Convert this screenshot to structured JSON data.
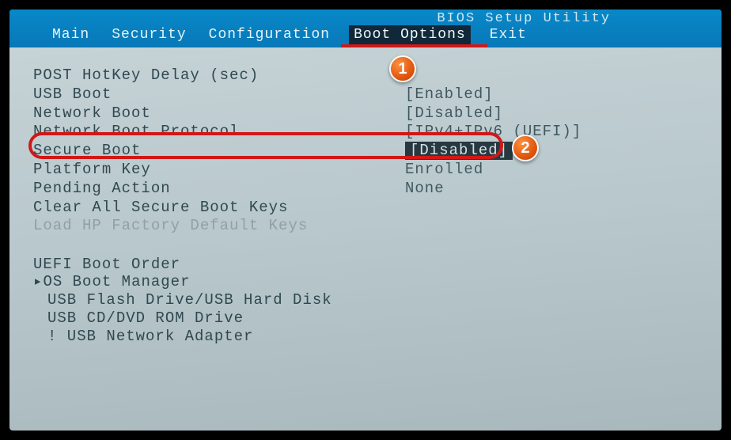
{
  "header": {
    "title": "BIOS Setup Utility",
    "menu": [
      "Main",
      "Security",
      "Configuration",
      "Boot Options",
      "Exit"
    ],
    "active_index": 3
  },
  "settings": [
    {
      "label": "POST HotKey Delay (sec)",
      "value": ""
    },
    {
      "label": "USB Boot",
      "value": "[Enabled]"
    },
    {
      "label": "Network Boot",
      "value": "[Disabled]"
    },
    {
      "label": "Network Boot Protocol",
      "value": "[IPv4+IPv6 (UEFI)]"
    },
    {
      "label": "Secure Boot",
      "value": "[Disabled]"
    },
    {
      "label": "Platform Key",
      "value": "Enrolled"
    },
    {
      "label": "Pending Action",
      "value": "None"
    },
    {
      "label": "Clear All Secure Boot Keys",
      "value": ""
    },
    {
      "label": "Load HP Factory Default Keys",
      "value": ""
    }
  ],
  "boot_order": {
    "title": "UEFI Boot Order",
    "items": [
      "OS Boot Manager",
      "USB Flash Drive/USB Hard Disk",
      "USB CD/DVD ROM Drive",
      "! USB Network Adapter"
    ]
  },
  "annotations": {
    "badge1": "1",
    "badge2": "2"
  }
}
